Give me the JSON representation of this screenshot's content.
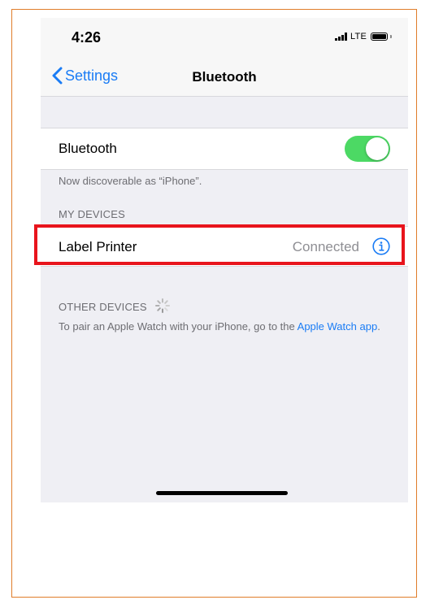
{
  "status_bar": {
    "time": "4:26",
    "network": "LTE"
  },
  "nav": {
    "back_label": "Settings",
    "title": "Bluetooth"
  },
  "bluetooth_row": {
    "label": "Bluetooth",
    "toggle_on": true
  },
  "discoverable_text": "Now discoverable as “iPhone”.",
  "my_devices": {
    "header": "MY DEVICES",
    "devices": [
      {
        "name": "Label Printer",
        "status": "Connected"
      }
    ]
  },
  "other_devices": {
    "header": "OTHER DEVICES",
    "pair_text": "To pair an Apple Watch with your iPhone, go to the ",
    "pair_link": "Apple Watch app",
    "pair_suffix": "."
  },
  "colors": {
    "accent": "#1a7cf5",
    "toggle_on": "#4cd964",
    "highlight": "#e8141c",
    "frame": "#e07d2a"
  }
}
